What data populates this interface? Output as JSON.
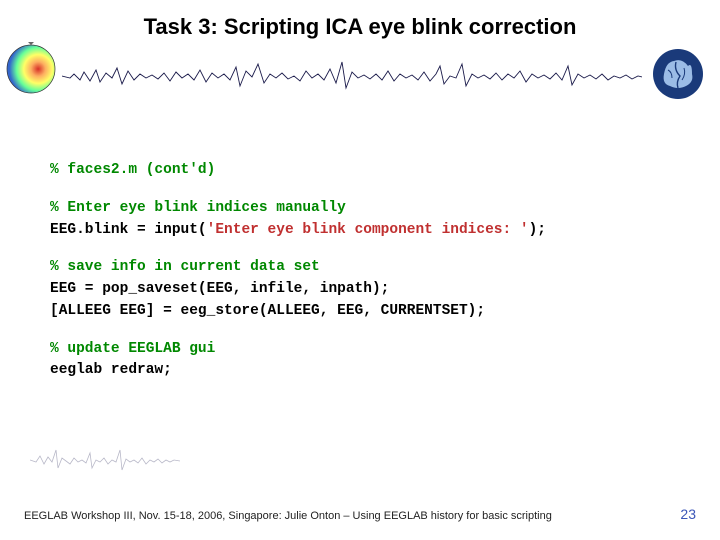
{
  "title": "Task 3: Scripting ICA eye blink correction",
  "code": {
    "l1_comment": "% faces2.m (cont'd)",
    "l2_comment": "% Enter eye blink indices manually",
    "l3a": " EEG.blink = input(",
    "l3b_string": "'Enter eye blink component indices: '",
    "l3c": ");",
    "l4_comment": "% save info in current data set",
    "l5": " EEG = pop_saveset(EEG, infile, inpath);",
    "l6": " [ALLEEG EEG] = eeg_store(ALLEEG, EEG, CURRENTSET);",
    "l7_comment": "% update EEGLAB gui",
    "l8": " eeglab redraw;"
  },
  "footer": "EEGLAB Workshop III, Nov. 15-18, 2006, Singapore: Julie Onton – Using EEGLAB history for basic scripting",
  "slide_number": "23",
  "icons": {
    "head": "head-topography-icon",
    "brain": "brain-logo-icon"
  }
}
